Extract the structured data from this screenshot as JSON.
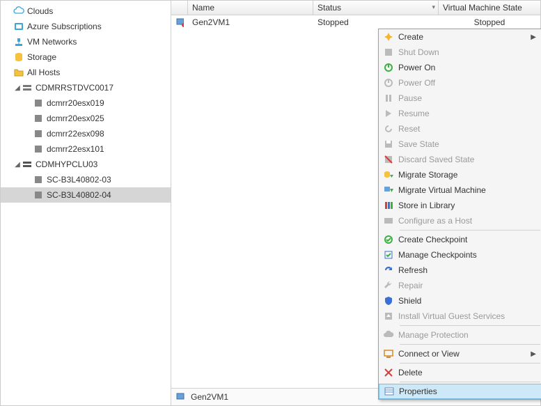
{
  "sidebar": {
    "items": [
      {
        "label": "Clouds",
        "icon": "cloud"
      },
      {
        "label": "Azure Subscriptions",
        "icon": "azure"
      },
      {
        "label": "VM Networks",
        "icon": "vmnetwork"
      },
      {
        "label": "Storage",
        "icon": "storage"
      },
      {
        "label": "All Hosts",
        "icon": "folder"
      }
    ],
    "cluster1": {
      "label": "CDMRRSTDVC0017",
      "hosts": [
        "dcmrr20esx019",
        "dcmrr20esx025",
        "dcmrr22esx098",
        "dcmrr22esx101"
      ]
    },
    "cluster2": {
      "label": "CDMHYPCLU03",
      "hosts": [
        "SC-B3L40802-03",
        "SC-B3L40802-04"
      ]
    }
  },
  "grid": {
    "columns": {
      "name": "Name",
      "status": "Status",
      "vmstate": "Virtual Machine State"
    },
    "rows": [
      {
        "name": "Gen2VM1",
        "status": "Stopped",
        "vmstate": "Stopped"
      }
    ]
  },
  "statusbar": {
    "label": "Gen2VM1"
  },
  "contextmenu": {
    "items": [
      {
        "label": "Create",
        "icon": "create",
        "enabled": true,
        "submenu": true
      },
      {
        "label": "Shut Down",
        "icon": "shutdown",
        "enabled": false
      },
      {
        "label": "Power On",
        "icon": "poweron",
        "enabled": true
      },
      {
        "label": "Power Off",
        "icon": "poweroff",
        "enabled": false
      },
      {
        "label": "Pause",
        "icon": "pause",
        "enabled": false
      },
      {
        "label": "Resume",
        "icon": "resume",
        "enabled": false
      },
      {
        "label": "Reset",
        "icon": "reset",
        "enabled": false
      },
      {
        "label": "Save State",
        "icon": "savestate",
        "enabled": false
      },
      {
        "label": "Discard Saved State",
        "icon": "discard",
        "enabled": false
      },
      {
        "label": "Migrate Storage",
        "icon": "migratestorage",
        "enabled": true
      },
      {
        "label": "Migrate Virtual Machine",
        "icon": "migratevm",
        "enabled": true
      },
      {
        "label": "Store in Library",
        "icon": "library",
        "enabled": true
      },
      {
        "label": "Configure as a Host",
        "icon": "confighost",
        "enabled": false
      },
      {
        "sep": true
      },
      {
        "label": "Create Checkpoint",
        "icon": "checkpoint",
        "enabled": true
      },
      {
        "label": "Manage Checkpoints",
        "icon": "managecheck",
        "enabled": true
      },
      {
        "label": "Refresh",
        "icon": "refresh",
        "enabled": true
      },
      {
        "label": "Repair",
        "icon": "repair",
        "enabled": false
      },
      {
        "label": "Shield",
        "icon": "shield",
        "enabled": true
      },
      {
        "label": "Install Virtual Guest Services",
        "icon": "installguest",
        "enabled": false
      },
      {
        "sep": true
      },
      {
        "label": "Manage Protection",
        "icon": "protection",
        "enabled": false
      },
      {
        "sep": true
      },
      {
        "label": "Connect or View",
        "icon": "connect",
        "enabled": true,
        "submenu": true
      },
      {
        "sep": true
      },
      {
        "label": "Delete",
        "icon": "delete",
        "enabled": true
      },
      {
        "sep": true
      },
      {
        "label": "Properties",
        "icon": "properties",
        "enabled": true,
        "highlight": true
      }
    ]
  }
}
